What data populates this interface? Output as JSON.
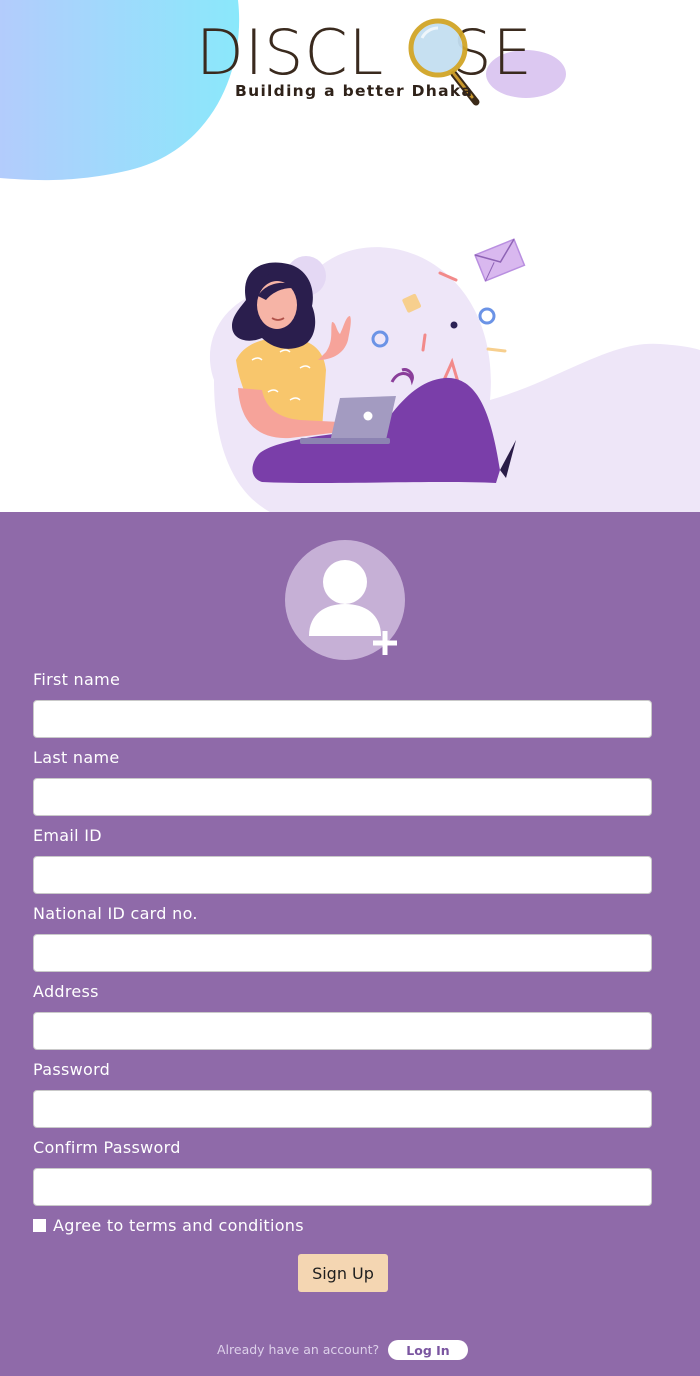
{
  "brand": {
    "name_left": "DISCL",
    "name_right": "SE",
    "tagline": "Building a better Dhaka",
    "logo_icon": "magnifying-glass-icon"
  },
  "illustration": {
    "icon": "woman-with-laptop-illustration"
  },
  "colors": {
    "form_background": "#8f6aa9",
    "signup_button": "#f4d6b2",
    "hero_blob_cyan": "#8fe6fb",
    "illustration_blob": "#eee6f8"
  },
  "avatar": {
    "icon": "user-avatar-icon",
    "add_icon": "plus-icon"
  },
  "form": {
    "first_name": {
      "label": "First name",
      "value": "",
      "placeholder": ""
    },
    "last_name": {
      "label": "Last name",
      "value": "",
      "placeholder": ""
    },
    "email": {
      "label": "Email ID",
      "value": "",
      "placeholder": ""
    },
    "national_id": {
      "label": "National ID card no.",
      "value": "",
      "placeholder": ""
    },
    "address": {
      "label": "Address",
      "value": "",
      "placeholder": ""
    },
    "password": {
      "label": "Password",
      "value": "",
      "placeholder": ""
    },
    "confirm_password": {
      "label": "Confirm Password",
      "value": "",
      "placeholder": ""
    },
    "terms_label": "Agree to terms and conditions",
    "terms_checked": false,
    "signup_label": "Sign Up"
  },
  "footer": {
    "prompt": "Already have an account?",
    "login_label": "Log In"
  }
}
